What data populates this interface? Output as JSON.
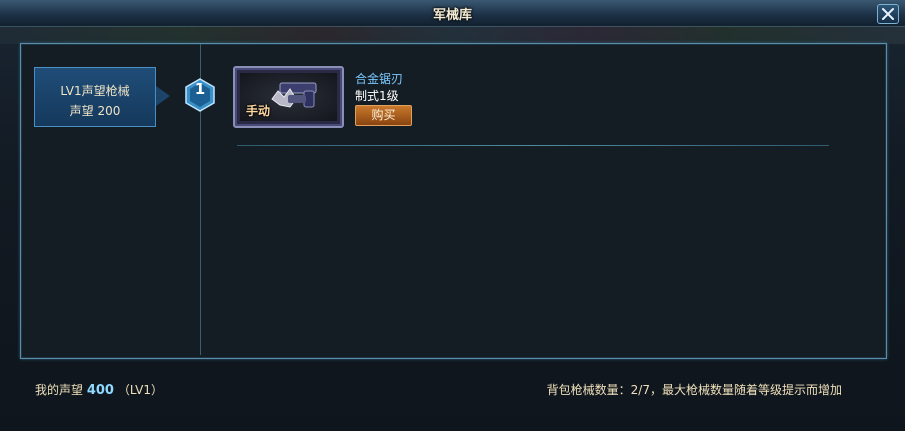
{
  "window": {
    "title": "军械库"
  },
  "tier": {
    "name": "LV1声望枪械",
    "requirement": "声望 200",
    "badge": "1"
  },
  "item": {
    "name": "合金锯刃",
    "level": "制式1级",
    "tag": "手动",
    "buy_label": "购买",
    "icon": "saw-blade-gun-icon"
  },
  "footer": {
    "reputation_label": "我的声望",
    "reputation_value": "400",
    "reputation_level": "（LV1）",
    "capacity_text": "背包枪械数量：2/7，最大枪械数量随着等级提示而增加"
  },
  "colors": {
    "accent": "#4a8fc4",
    "item_name": "#7cc8ff",
    "buy_button": "#c9792c",
    "badge": "#3a90c8"
  }
}
